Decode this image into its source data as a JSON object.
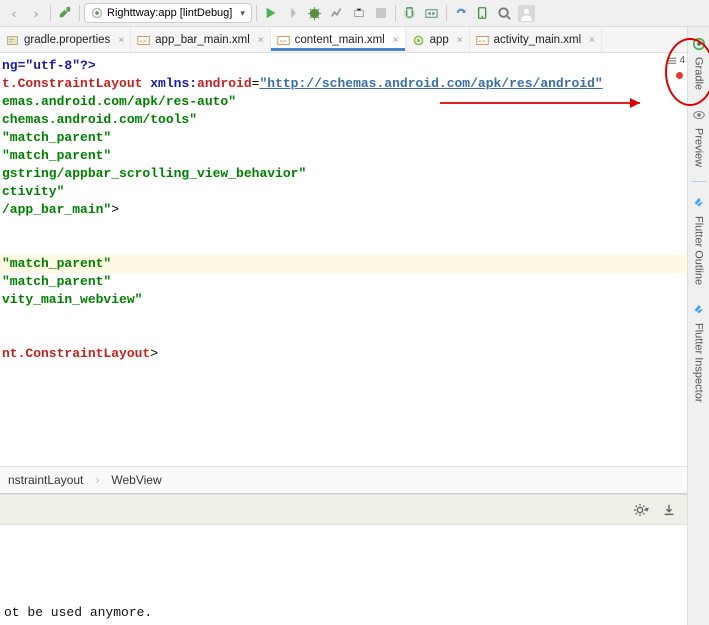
{
  "runConfig": {
    "label": "Righttway:app [lintDebug]"
  },
  "tabs": [
    {
      "label": "gradle.properties"
    },
    {
      "label": "app_bar_main.xml"
    },
    {
      "label": "content_main.xml",
      "active": true
    },
    {
      "label": "app"
    },
    {
      "label": "activity_main.xml"
    }
  ],
  "rightSidebar": {
    "gradle": "Gradle",
    "preview": "Preview",
    "flutterOutline": "Flutter Outline",
    "flutterInspector": "Flutter Inspector"
  },
  "problemsCount": "4",
  "code": {
    "l1": "ng=\"utf-8\"?>",
    "l2a": "t.ConstraintLayout ",
    "l2b": "xmlns:",
    "l2c": "android",
    "l2d": "=",
    "l2url": "\"http://schemas.android.com/apk/res/android\"",
    "l3": "emas.android.com/apk/res-auto\"",
    "l4": "chemas.android.com/tools\"",
    "l5": "\"match_parent\"",
    "l6": "\"match_parent\"",
    "l7": "gstring/appbar_scrolling_view_behavior\"",
    "l8": "ctivity\"",
    "l9": "/app_bar_main\"",
    "l9b": ">",
    "l10": "\"match_parent\"",
    "l11": "\"match_parent\"",
    "l12": "vity_main_webview\"",
    "l14a": "nt.ConstraintLayout",
    "l14b": ">"
  },
  "breadcrumb": {
    "a": "nstraintLayout",
    "b": "WebView"
  },
  "bottomMessage": "ot be used anymore."
}
